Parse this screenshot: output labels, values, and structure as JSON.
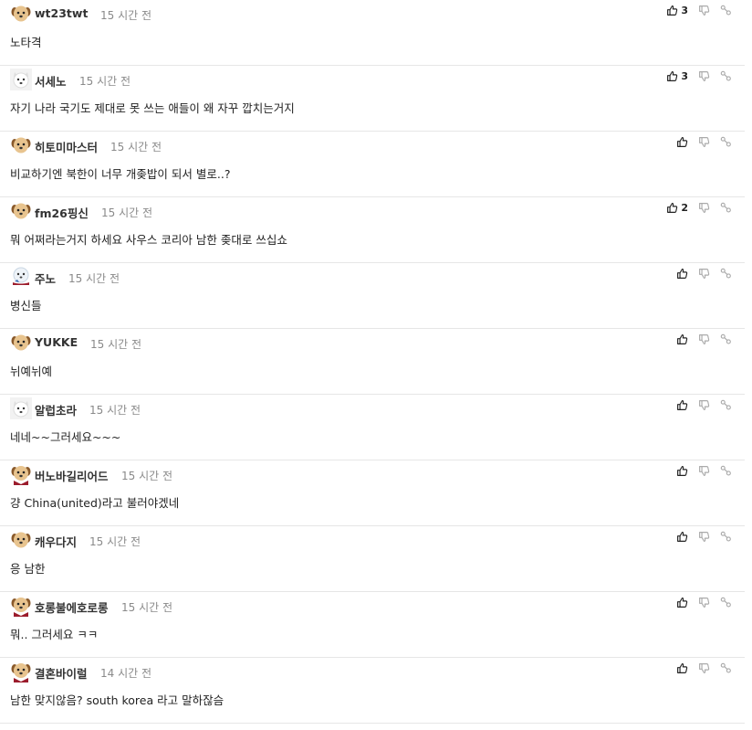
{
  "comments": [
    {
      "nick": "wt23twt",
      "time": "15 시간 전",
      "text": "노타격",
      "likes": "3",
      "avatar": "puppy-tan"
    },
    {
      "nick": "서세노",
      "time": "15 시간 전",
      "text": "자기 나라 국기도 제대로 못 쓰는 애들이 왜 자꾸 깝치는거지",
      "likes": "3",
      "avatar": "puppy-white"
    },
    {
      "nick": "히토미마스터",
      "time": "15 시간 전",
      "text": "비교하기엔 북한이 너무 개좆밥이 되서 별로..?",
      "likes": "",
      "avatar": "puppy-tan"
    },
    {
      "nick": "fm26핑신",
      "time": "15 시간 전",
      "text": "뭐 어쩌라는거지 하세요 사우스 코리아 남한 좆대로 쓰십쇼",
      "likes": "2",
      "avatar": "puppy-tan"
    },
    {
      "nick": "주노",
      "time": "15 시간 전",
      "text": "병신들",
      "likes": "",
      "avatar": "puppy-scarf"
    },
    {
      "nick": "YUKKE",
      "time": "15 시간 전",
      "text": "뉘예뉘예",
      "likes": "",
      "avatar": "puppy-tan"
    },
    {
      "nick": "알럽초라",
      "time": "15 시간 전",
      "text": "네네~~그러세요~~~",
      "likes": "",
      "avatar": "puppy-white"
    },
    {
      "nick": "버노바길리어드",
      "time": "15 시간 전",
      "text": "걍 China(united)라고 불러야겠네",
      "likes": "",
      "avatar": "puppy-tan-red"
    },
    {
      "nick": "캐우다지",
      "time": "15 시간 전",
      "text": "응 남한",
      "likes": "",
      "avatar": "puppy-tan"
    },
    {
      "nick": "호롱불에호로롱",
      "time": "15 시간 전",
      "text": "뭐.. 그러세요 ㅋㅋ",
      "likes": "",
      "avatar": "puppy-tan-red"
    },
    {
      "nick": "결혼바이럴",
      "time": "14 시간 전",
      "text": "남한 맞지않음? south korea 라고 말하잖슴",
      "likes": "",
      "avatar": "puppy-tan-red"
    }
  ],
  "icons": {
    "like": "thumbs-up-icon",
    "dislike": "thumbs-down-icon",
    "share": "share-icon"
  }
}
